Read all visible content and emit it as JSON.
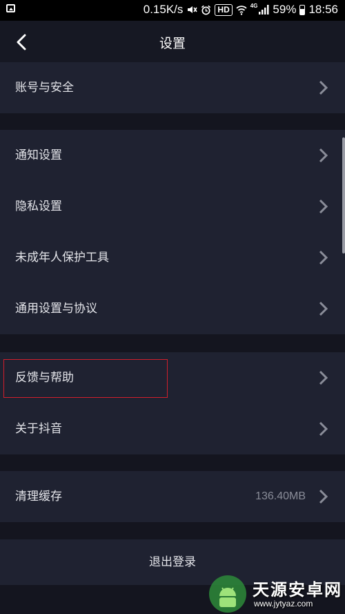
{
  "status_bar": {
    "speed": "0.15K/s",
    "hd": "HD",
    "net": "4G",
    "battery": "59%",
    "time": "18:56"
  },
  "header": {
    "title": "设置"
  },
  "groups": [
    {
      "rows": [
        {
          "label": "账号与安全"
        }
      ]
    },
    {
      "rows": [
        {
          "label": "通知设置"
        },
        {
          "label": "隐私设置"
        },
        {
          "label": "未成年人保护工具"
        },
        {
          "label": "通用设置与协议"
        }
      ]
    },
    {
      "rows": [
        {
          "label": "反馈与帮助"
        },
        {
          "label": "关于抖音"
        }
      ]
    },
    {
      "rows": [
        {
          "label": "清理缓存",
          "value": "136.40MB"
        }
      ]
    }
  ],
  "logout": {
    "label": "退出登录"
  },
  "watermark": {
    "text": "天源安卓网",
    "url": "www.jytyaz.com"
  },
  "colors": {
    "background": "#14151f",
    "card": "#1f2231",
    "highlight": "#d21f2c"
  }
}
